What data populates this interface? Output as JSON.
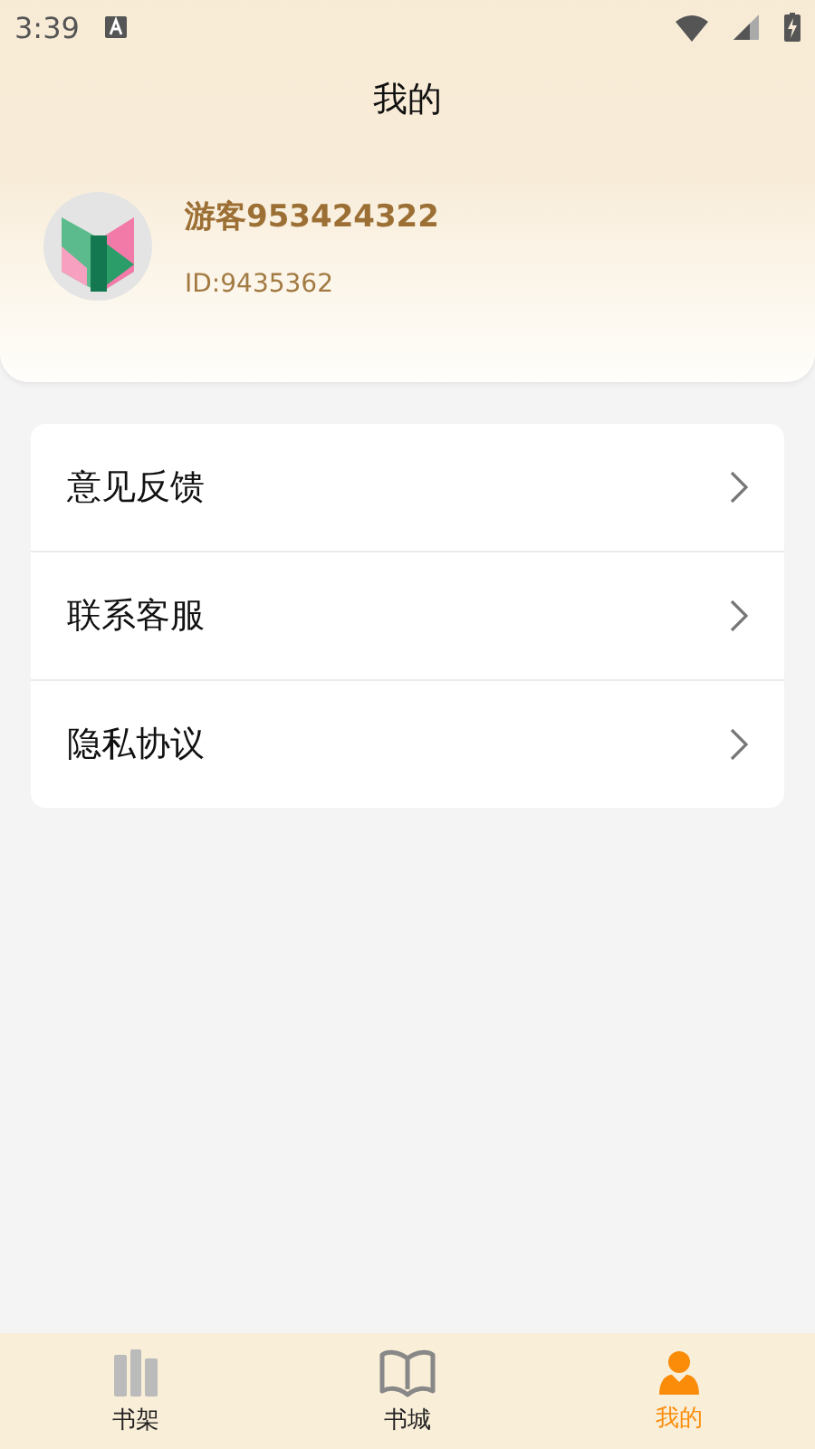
{
  "status_bar": {
    "time": "3:39"
  },
  "header": {
    "title": "我的"
  },
  "profile": {
    "name": "游客953424322",
    "id": "ID:9435362"
  },
  "menu": [
    {
      "label": "意见反馈"
    },
    {
      "label": "联系客服"
    },
    {
      "label": "隐私协议"
    }
  ],
  "tabs": [
    {
      "label": "书架",
      "kind": "shelf",
      "selected": false
    },
    {
      "label": "书城",
      "kind": "book",
      "selected": false
    },
    {
      "label": "我的",
      "kind": "person",
      "selected": true
    }
  ]
}
